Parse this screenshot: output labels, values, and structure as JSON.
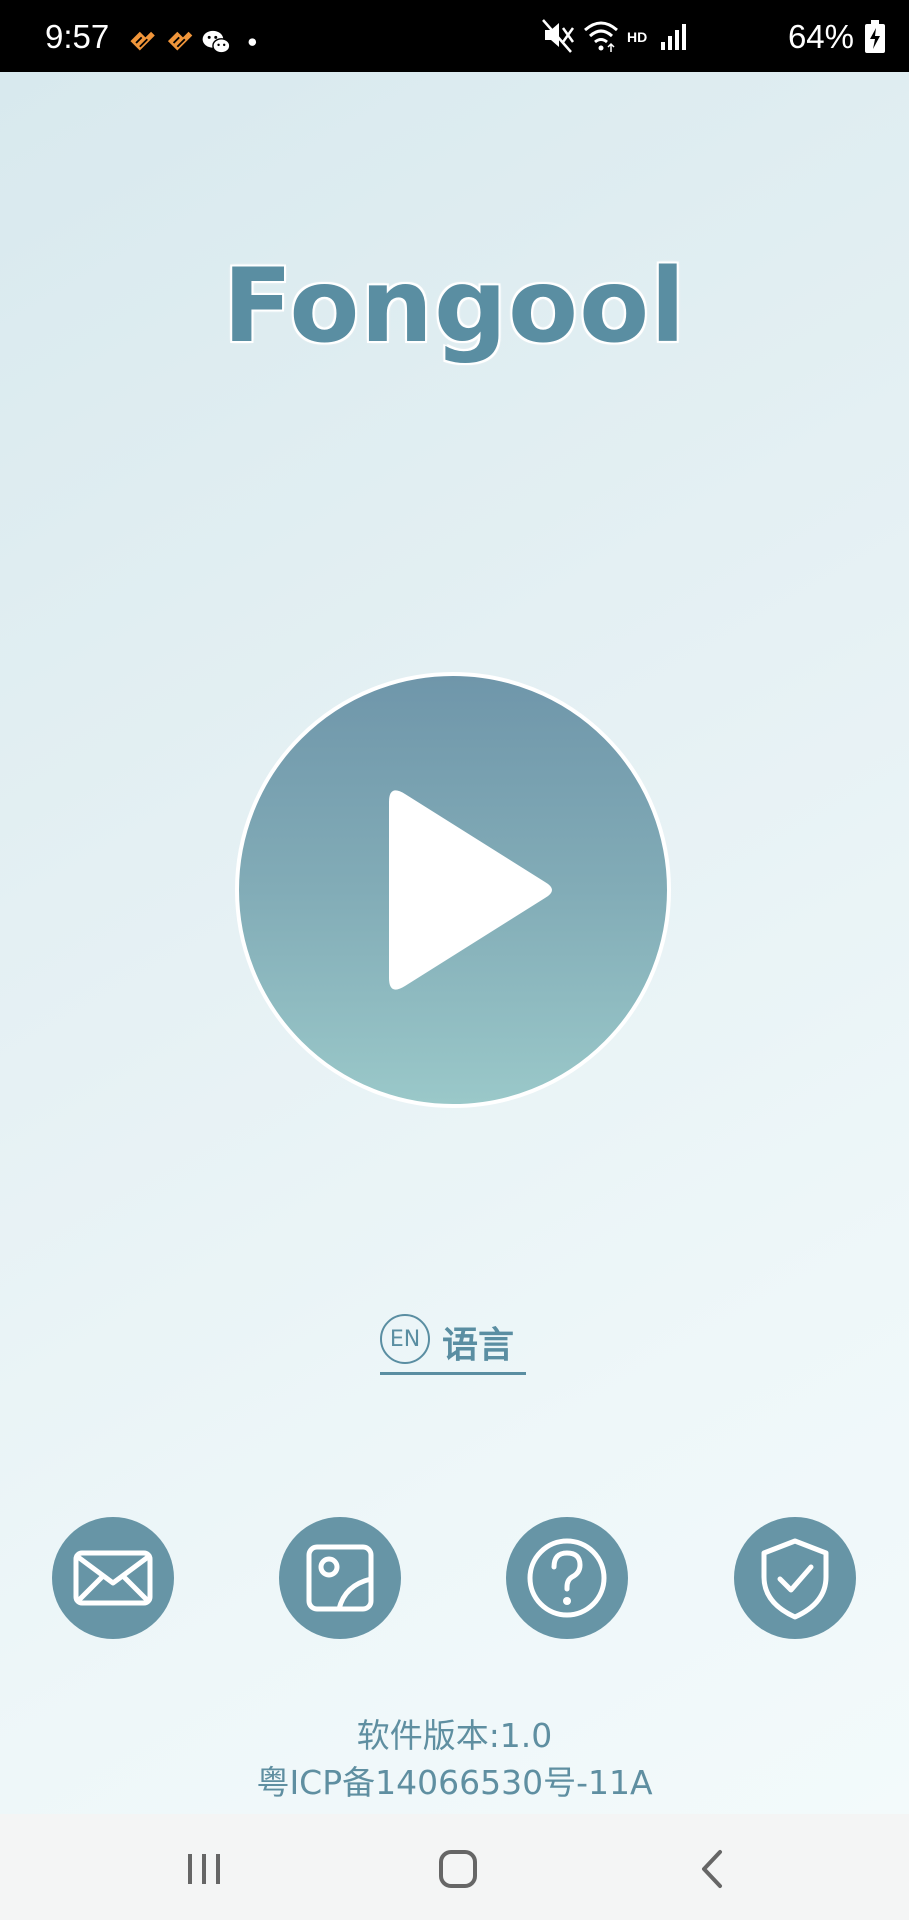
{
  "status_bar": {
    "time": "9:57",
    "battery": "64%",
    "network_label": "HD",
    "notification_icons": [
      "app-notification-icon",
      "app-notification-icon",
      "wechat-icon",
      "dot-icon"
    ],
    "system_icons": [
      "mute-icon",
      "wifi-icon",
      "hd-icon",
      "signal-icon",
      "battery-charging-icon"
    ]
  },
  "app": {
    "title": "Fongool",
    "play_button_icon": "play-icon",
    "language": {
      "badge": "EN",
      "label": "语言"
    },
    "actions": [
      {
        "icon": "mail-icon"
      },
      {
        "icon": "gallery-icon"
      },
      {
        "icon": "help-icon"
      },
      {
        "icon": "shield-check-icon"
      }
    ],
    "footer": {
      "version": "软件版本:1.0",
      "icp": "粤ICP备14066530号-11A"
    }
  },
  "nav_bar": {
    "icons": [
      "recent-apps-icon",
      "home-icon",
      "back-icon"
    ]
  },
  "colors": {
    "accent": "#5a8ea2",
    "button_fill": "#6795a6",
    "status_bar_bg": "#000000",
    "nav_bar_bg": "#f4f5f5",
    "notification_orange": "#f0953a"
  }
}
